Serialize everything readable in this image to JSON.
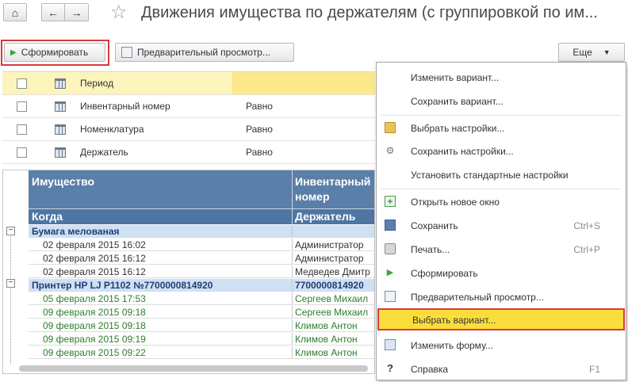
{
  "header": {
    "title": "Движения имущества по держателям (с группировкой по им..."
  },
  "toolbar": {
    "generate_label": "Сформировать",
    "preview_label": "Предварительный просмотр...",
    "more_label": "Еще"
  },
  "filters": [
    {
      "name": "Период",
      "condition": ""
    },
    {
      "name": "Инвентарный номер",
      "condition": "Равно"
    },
    {
      "name": "Номенклатура",
      "condition": "Равно"
    },
    {
      "name": "Держатель",
      "condition": "Равно"
    }
  ],
  "report": {
    "headers": {
      "col1_top": "Имущество",
      "col2_top_line1": "Инвентарный",
      "col2_top_line2": "номер",
      "col1_bottom": "Когда",
      "col2_bottom": "Держатель"
    },
    "rows": [
      {
        "type": "group",
        "c1": "Бумага мелованая",
        "c2": ""
      },
      {
        "type": "item",
        "c1": "02 февраля 2015 16:02",
        "c2": "Администратор"
      },
      {
        "type": "item",
        "c1": "02 февраля 2015 16:12",
        "c2": "Администратор"
      },
      {
        "type": "item",
        "c1": "02 февраля 2015 16:12",
        "c2": "Медведев Дмитр"
      },
      {
        "type": "group",
        "c1": "Принтер HP LJ P1102 №7700000814920",
        "c2": "7700000814920"
      },
      {
        "type": "green",
        "c1": "05 февраля 2015 17:53",
        "c2": "Сергеев Михаил"
      },
      {
        "type": "green",
        "c1": "09 февраля 2015 09:18",
        "c2": "Сергеев Михаил"
      },
      {
        "type": "green",
        "c1": "09 февраля 2015 09:18",
        "c2": "Климов Антон"
      },
      {
        "type": "green",
        "c1": "09 февраля 2015 09:19",
        "c2": "Климов Антон"
      },
      {
        "type": "green",
        "c1": "09 февраля 2015 09:22",
        "c2": "Климов Антон"
      }
    ]
  },
  "menu": {
    "items": {
      "change_variant": "Изменить вариант...",
      "save_variant": "Сохранить вариант...",
      "select_settings": "Выбрать настройки...",
      "save_settings": "Сохранить настройки...",
      "standard_settings": "Установить стандартные настройки",
      "open_new_window": "Открыть новое окно",
      "save": "Сохранить",
      "save_shortcut": "Ctrl+S",
      "print": "Печать...",
      "print_shortcut": "Ctrl+P",
      "generate": "Сформировать",
      "preview": "Предварительный просмотр...",
      "select_variant": "Выбрать вариант...",
      "change_form": "Изменить форму...",
      "help": "Справка",
      "help_shortcut": "F1"
    }
  }
}
